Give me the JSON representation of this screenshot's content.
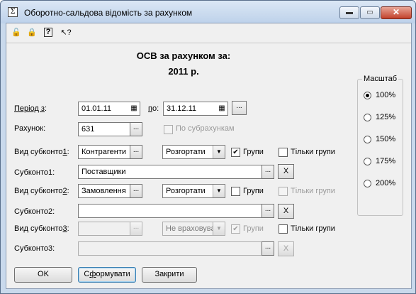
{
  "window": {
    "title": "Оборотно-сальдова відомість за рахунком",
    "app_icon_glyph": "Σ",
    "minimize_glyph": "▬",
    "maximize_glyph": "▭",
    "close_glyph": "✕"
  },
  "toolbar": {
    "icons": [
      "lock-open-icon",
      "lock-icon",
      "help-icon",
      "context-help-icon"
    ],
    "glyphs": [
      "🔓",
      "🔒",
      "?",
      "↖?"
    ]
  },
  "report": {
    "heading_line1": "ОСВ за рахунком за:",
    "heading_line2": "2011 р."
  },
  "period": {
    "label_prefix": "Період з",
    "label_suffix": ":",
    "from_value": "01.01.11",
    "to_label_prefix": "п",
    "to_label_suffix": "о:",
    "to_value": "31.12.11",
    "ellipsis": "..."
  },
  "account": {
    "label": "Рахунок:",
    "value": "631",
    "ellipsis": "...",
    "by_subaccounts_label": "По субрахункам",
    "by_subaccounts_checked": false
  },
  "subconto_rows": [
    {
      "kind_label_prefix": "Вид субконто",
      "kind_label_num": "1",
      "kind_label_suffix": ":",
      "kind_value": "Контрагенти",
      "mode": "Розгортати",
      "groups_label": "Групи",
      "groups_checked": true,
      "only_groups_label": "Тільки групи",
      "only_groups_checked": false,
      "value_label": "Субконто1:",
      "value": "Поставщики",
      "clear_label": "X",
      "enabled": true
    },
    {
      "kind_label_prefix": "Вид субконто",
      "kind_label_num": "2",
      "kind_label_suffix": ":",
      "kind_value": "Замовлення",
      "mode": "Розгортати",
      "groups_label": "Групи",
      "groups_checked": false,
      "only_groups_label": "Тільки групи",
      "only_groups_checked": false,
      "value_label": "Субконто2:",
      "value": "",
      "clear_label": "X",
      "enabled": true
    },
    {
      "kind_label_prefix": "Вид субконто",
      "kind_label_num": "3",
      "kind_label_suffix": ":",
      "kind_value": "",
      "mode": "Не враховувати",
      "groups_label": "Групи",
      "groups_checked": true,
      "only_groups_label": "Тільки групи",
      "only_groups_checked": false,
      "value_label": "Субконто3:",
      "value": "",
      "clear_label": "X",
      "enabled": false
    }
  ],
  "scale": {
    "legend": "Масштаб",
    "options": [
      "100%",
      "125%",
      "150%",
      "175%",
      "200%"
    ],
    "selected": "100%"
  },
  "buttons": {
    "ok": "OK",
    "generate_prefix": "С",
    "generate_underlined": "ф",
    "generate_suffix": "ормувати",
    "close": "Закрити"
  }
}
